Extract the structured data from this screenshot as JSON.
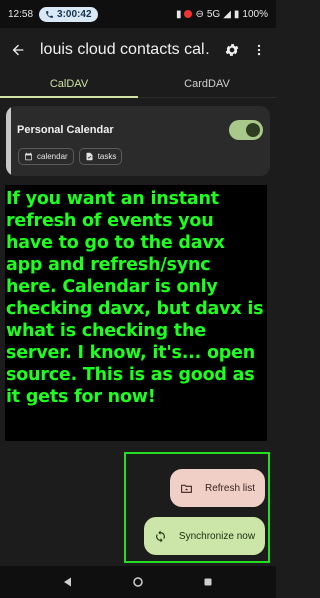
{
  "status_bar": {
    "time": "12:58",
    "call_timer": "3:00:42",
    "network": "5G",
    "battery": "100%"
  },
  "app_bar": {
    "title": "louis cloud contacts cal…"
  },
  "tabs": [
    {
      "label": "CalDAV",
      "active": true
    },
    {
      "label": "CardDAV",
      "active": false
    }
  ],
  "calendar_card": {
    "name": "Personal Calendar",
    "enabled": true,
    "chips": [
      {
        "label": "calendar",
        "icon": "calendar-icon"
      },
      {
        "label": "tasks",
        "icon": "tasks-icon"
      }
    ]
  },
  "overlay_note": {
    "text": "If you want an instant refresh of events you have to go to the davx app and refresh/sync here. Calendar is only checking davx, but davx is what is checking the server. I know, it's... open source. This is as good as it gets for now!"
  },
  "actions": {
    "refresh_label": "Refresh list",
    "sync_label": "Synchronize now"
  },
  "colors": {
    "accent": "#cfe2a4",
    "overlay_text": "#1dff1d",
    "highlight_border": "#22dd22",
    "refresh_bg": "#f0cfc6",
    "sync_bg": "#cbe6a8"
  }
}
